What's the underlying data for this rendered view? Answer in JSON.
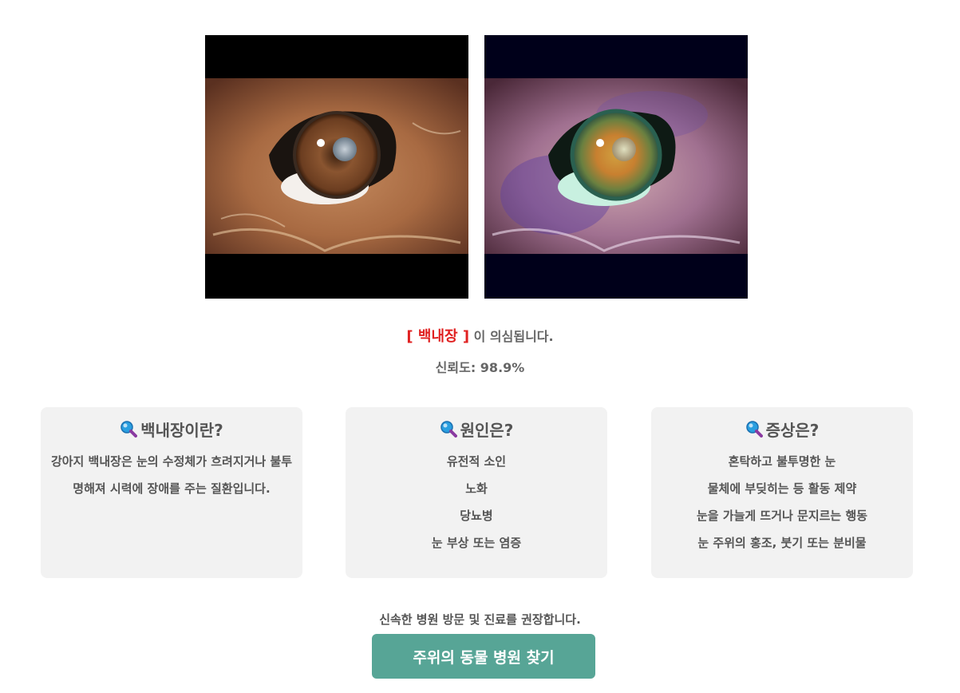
{
  "images": {
    "original_alt": "original eye image",
    "heatmap_alt": "heatmap eye image"
  },
  "result": {
    "diagnosis": "[ 백내장 ]",
    "suffix": " 이 의심됩니다.",
    "confidence": "신뢰도: 98.9%"
  },
  "cards": {
    "about": {
      "title": "백내장이란?",
      "text": "강아지 백내장은 눈의 수정체가 흐려지거나 불투명해져 시력에 장애를 주는 질환입니다."
    },
    "causes": {
      "title": "원인은?",
      "items": [
        "유전적 소인",
        "노화",
        "당뇨병",
        "눈 부상 또는 염증"
      ]
    },
    "symptoms": {
      "title": "증상은?",
      "items": [
        "혼탁하고 불투명한 눈",
        "물체에 부딪히는 등 활동 제약",
        "눈을 가늘게 뜨거나 문지르는 행동",
        "눈 주위의 홍조, 붓기 또는 분비물"
      ]
    }
  },
  "recommend": "신속한 병원 방문 및 진료를 권장합니다.",
  "button": {
    "label": "주위의 동물 병원 찾기"
  },
  "colors": {
    "accent": "#57a596",
    "diagnosis": "#e02020",
    "card_bg": "#f2f2f2"
  }
}
